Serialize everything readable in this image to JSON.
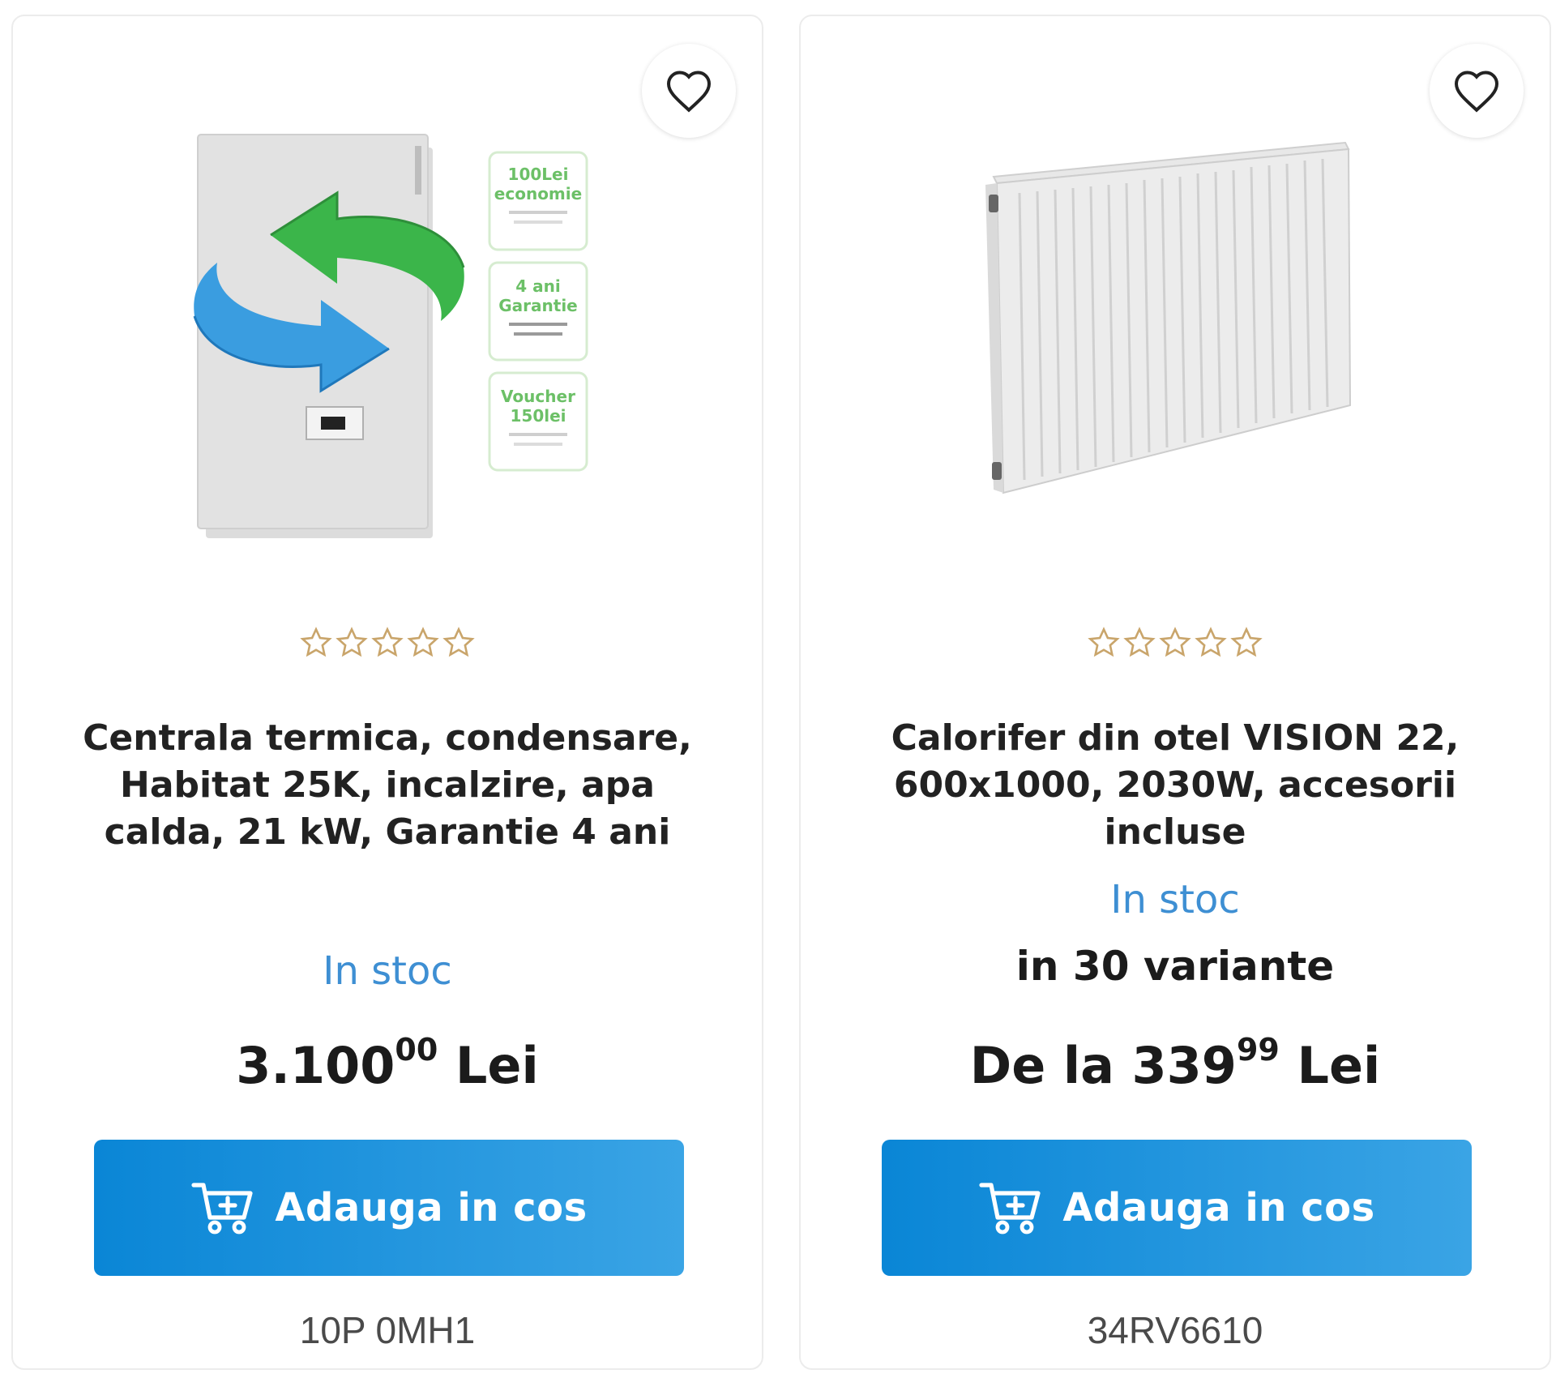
{
  "products": [
    {
      "title": "Centrala termica, condensare, Habitat 25K, incalzire, apa calda, 21 kW, Garantie 4 ani",
      "rating": 0,
      "stock": "In stoc",
      "price_prefix": "",
      "price_int": "3.100",
      "price_dec": "00",
      "currency": "Lei",
      "cart_label": "Adauga in cos",
      "sku": "10P 0MH1",
      "image_icon": "boiler-with-arrows-image",
      "badges": [
        {
          "line1": "100Lei",
          "line2": "economie"
        },
        {
          "line1": "4 ani",
          "line2": "Garantie"
        },
        {
          "line1": "Voucher",
          "line2": "150lei"
        }
      ]
    },
    {
      "title": "Calorifer din otel VISION 22, 600x1000, 2030W, accesorii incluse",
      "rating": 0,
      "stock": "In stoc",
      "variants": "in 30 variante",
      "price_prefix": "De la ",
      "price_int": "339",
      "price_dec": "99",
      "currency": "Lei",
      "cart_label": "Adauga in cos",
      "sku": "34RV6610",
      "image_icon": "radiator-image"
    }
  ],
  "colors": {
    "accent": "#0a86d6",
    "stock": "#3e8fd3",
    "star": "#c9a56b"
  }
}
